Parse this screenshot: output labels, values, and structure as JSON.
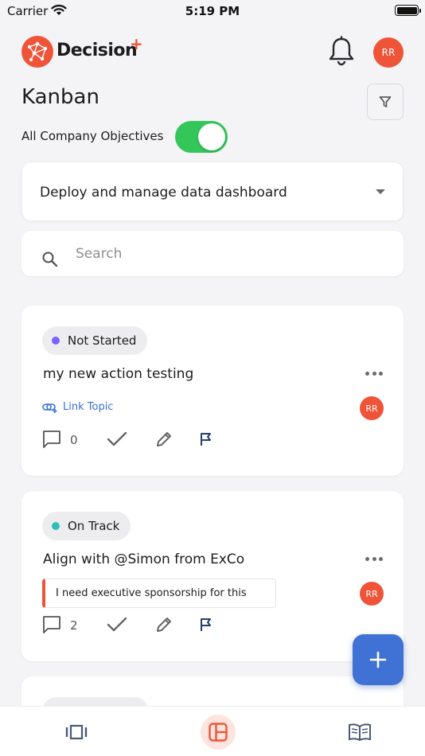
{
  "status_bar": {
    "carrier": "Carrier",
    "time": "5:19 PM"
  },
  "header": {
    "brand": "Decision",
    "brand_plus": "+",
    "user_initials": "RR",
    "page_title": "Kanban"
  },
  "filters": {
    "toggle_label": "All Company Objectives",
    "toggle_on": true,
    "objective_selected": "Deploy and manage data dashboard",
    "search_placeholder": "Search"
  },
  "cards": [
    {
      "status": "Not Started",
      "status_color": "#7b61ff",
      "title": "my new action testing",
      "link_label": "Link Topic",
      "assignee": "RR",
      "comment_count": "0"
    },
    {
      "status": "On Track",
      "status_color": "#2fbfb4",
      "title": "Align with @Simon from ExCo",
      "note": "I need executive sponsorship for this",
      "assignee": "RR",
      "comment_count": "2"
    }
  ],
  "colors": {
    "accent": "#ef5438",
    "fab": "#3f72d4",
    "toggle": "#33c759",
    "link": "#3a6fd6"
  },
  "tabs": [
    {
      "icon": "board-icon",
      "active": false
    },
    {
      "icon": "kanban-icon",
      "active": true
    },
    {
      "icon": "book-icon",
      "active": false
    }
  ]
}
